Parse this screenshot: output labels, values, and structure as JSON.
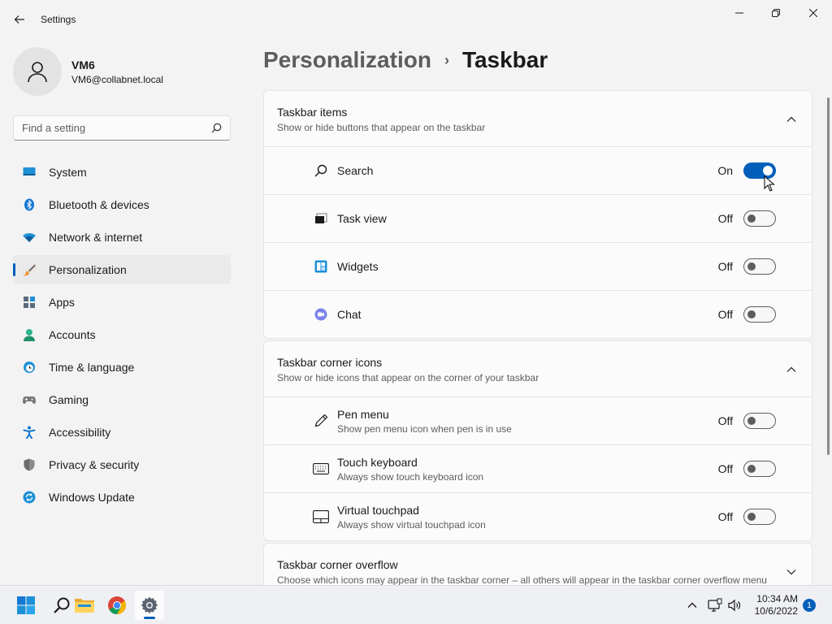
{
  "window": {
    "title": "Settings"
  },
  "profile": {
    "name": "VM6",
    "email": "VM6@collabnet.local"
  },
  "search": {
    "placeholder": "Find a setting"
  },
  "sidebar": {
    "items": [
      {
        "label": "System",
        "icon": "monitor-icon"
      },
      {
        "label": "Bluetooth & devices",
        "icon": "bluetooth-icon"
      },
      {
        "label": "Network & internet",
        "icon": "wifi-icon"
      },
      {
        "label": "Personalization",
        "icon": "brush-icon",
        "active": true
      },
      {
        "label": "Apps",
        "icon": "apps-icon"
      },
      {
        "label": "Accounts",
        "icon": "person-icon"
      },
      {
        "label": "Time & language",
        "icon": "clock-globe-icon"
      },
      {
        "label": "Gaming",
        "icon": "gamepad-icon"
      },
      {
        "label": "Accessibility",
        "icon": "accessibility-icon"
      },
      {
        "label": "Privacy & security",
        "icon": "shield-icon"
      },
      {
        "label": "Windows Update",
        "icon": "update-icon"
      }
    ]
  },
  "breadcrumb": {
    "parent": "Personalization",
    "separator": "›",
    "current": "Taskbar"
  },
  "sections": {
    "taskbar_items": {
      "title": "Taskbar items",
      "subtitle": "Show or hide buttons that appear on the taskbar",
      "expanded": true,
      "rows": [
        {
          "label": "Search",
          "state": "On",
          "on": true,
          "icon": "search-icon"
        },
        {
          "label": "Task view",
          "state": "Off",
          "on": false,
          "icon": "task-view-icon"
        },
        {
          "label": "Widgets",
          "state": "Off",
          "on": false,
          "icon": "widgets-icon"
        },
        {
          "label": "Chat",
          "state": "Off",
          "on": false,
          "icon": "chat-icon"
        }
      ]
    },
    "corner_icons": {
      "title": "Taskbar corner icons",
      "subtitle": "Show or hide icons that appear on the corner of your taskbar",
      "expanded": true,
      "rows": [
        {
          "label": "Pen menu",
          "desc": "Show pen menu icon when pen is in use",
          "state": "Off",
          "on": false,
          "icon": "pen-icon"
        },
        {
          "label": "Touch keyboard",
          "desc": "Always show touch keyboard icon",
          "state": "Off",
          "on": false,
          "icon": "keyboard-icon"
        },
        {
          "label": "Virtual touchpad",
          "desc": "Always show virtual touchpad icon",
          "state": "Off",
          "on": false,
          "icon": "touchpad-icon"
        }
      ]
    },
    "corner_overflow": {
      "title": "Taskbar corner overflow",
      "subtitle": "Choose which icons may appear in the taskbar corner – all others will appear in the taskbar corner overflow menu",
      "expanded": false
    }
  },
  "taskbar": {
    "apps": [
      "start-icon",
      "search-icon",
      "file-explorer-icon",
      "chrome-icon",
      "settings-icon"
    ],
    "time": "10:34 AM",
    "date": "10/6/2022",
    "notifications": "1"
  },
  "colors": {
    "accent": "#005fb8",
    "background": "#f3f3f3",
    "card": "#fbfbfb"
  }
}
